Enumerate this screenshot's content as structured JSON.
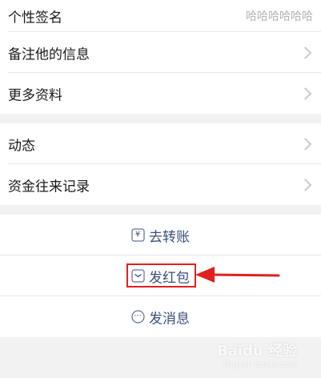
{
  "profile": {
    "signature": {
      "label": "个性签名",
      "value": "哈哈哈哈哈哈"
    },
    "remark": {
      "label": "备注他的信息"
    },
    "more_info": {
      "label": "更多资料"
    }
  },
  "activity": {
    "moments": {
      "label": "动态"
    },
    "fund_records": {
      "label": "资金往来记录"
    }
  },
  "actions": {
    "transfer": {
      "label": "去转账",
      "icon": "yuan-icon"
    },
    "red_packet": {
      "label": "发红包",
      "icon": "red-packet-icon"
    },
    "message": {
      "label": "发消息",
      "icon": "chat-bubble-icon"
    }
  },
  "annotation": {
    "highlight_color": "#e02020",
    "arrow_color": "#e02020"
  },
  "watermark": {
    "text": "Baidu 经验",
    "url": "jingyan.baidu.com"
  }
}
